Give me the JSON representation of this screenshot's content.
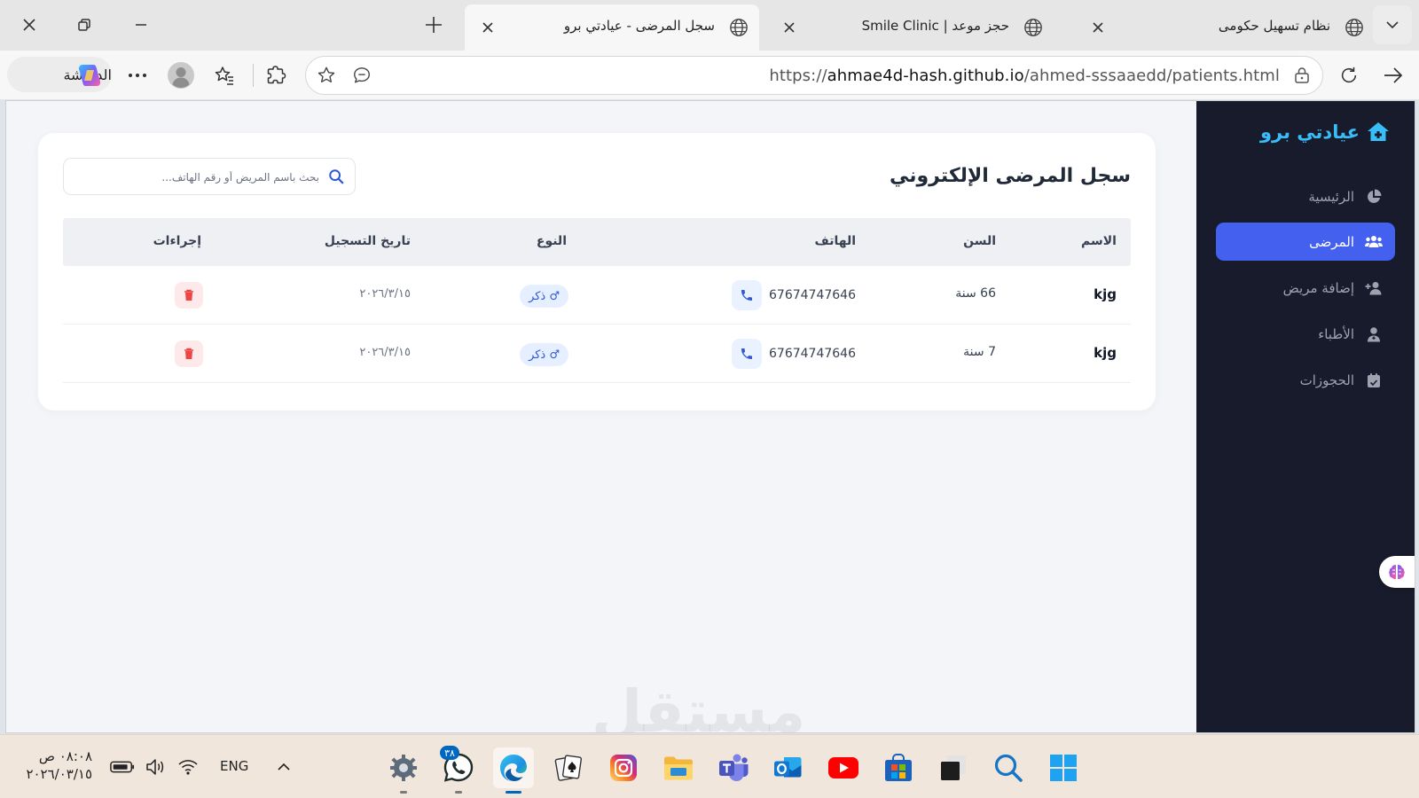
{
  "browser": {
    "tabs": [
      {
        "title": "سجل المرضى - عيادتي برو",
        "active": true
      },
      {
        "title": "حجز موعد | Smile Clinic",
        "active": false
      },
      {
        "title": "نظام تسهيل حكومى",
        "active": false
      }
    ],
    "copilot_label": "الدردشة",
    "url_prefix": "https://",
    "url_domain": "ahmae4d-hash.github.io",
    "url_path": "/ahmed-sssaaedd/patients.html"
  },
  "sidebar": {
    "brand": "عيادتي برو",
    "items": [
      {
        "label": "الرئيسية",
        "icon": "pie-chart-icon",
        "active": false
      },
      {
        "label": "المرضى",
        "icon": "users-icon",
        "active": true
      },
      {
        "label": "إضافة مريض",
        "icon": "user-plus-icon",
        "active": false
      },
      {
        "label": "الأطباء",
        "icon": "doctor-icon",
        "active": false
      },
      {
        "label": "الحجوزات",
        "icon": "calendar-icon",
        "active": false
      }
    ]
  },
  "main": {
    "title": "سجل المرضى الإلكتروني",
    "search_placeholder": "بحث باسم المريض أو رقم الهاتف...",
    "columns": {
      "name": "الاسم",
      "age": "السن",
      "phone": "الهاتف",
      "gender": "النوع",
      "date": "تاريخ التسجيل",
      "actions": "إجراءات"
    },
    "rows": [
      {
        "name": "kjg",
        "age": "66 سنة",
        "phone": "67674747646",
        "gender": "♂ ذكر",
        "date": "٢٠٢٦/٣/١٥"
      },
      {
        "name": "kjg",
        "age": "7 سنة",
        "phone": "67674747646",
        "gender": "♂ ذكر",
        "date": "٢٠٢٦/٣/١٥"
      }
    ]
  },
  "watermark": "مستقل",
  "taskbar": {
    "time": "٠٨:٠٨ ص",
    "date": "٢٠٢٦/٠٣/١٥",
    "language": "ENG",
    "whatsapp_badge": "٣٨"
  },
  "colors": {
    "sidebar_bg": "#181b2b",
    "brand": "#38bdf8",
    "active_nav": "#4361ee",
    "delete": "#ef4444"
  }
}
